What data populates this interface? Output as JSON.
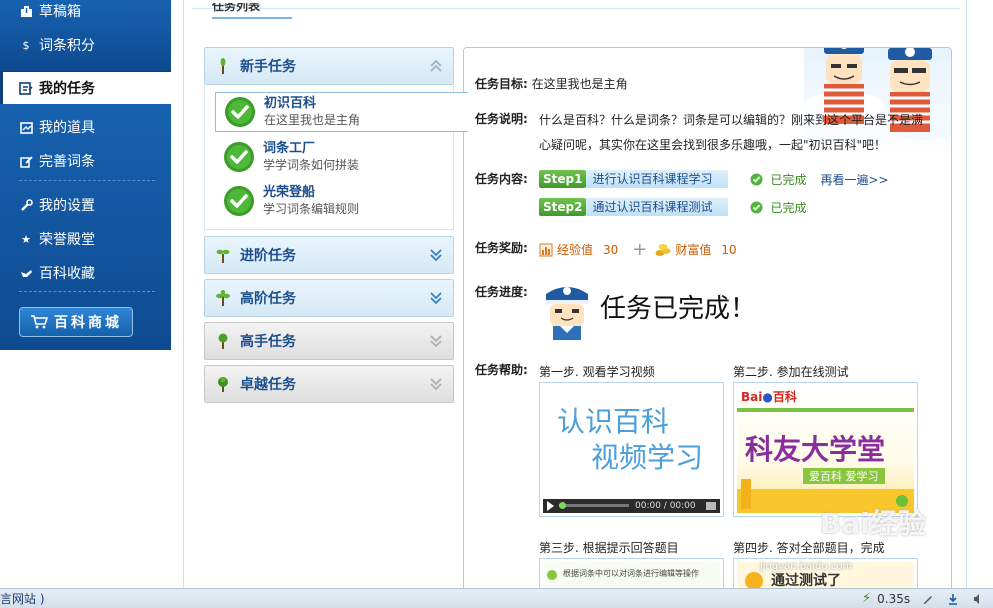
{
  "sidebar": {
    "items_top": [
      {
        "label": "草稿箱",
        "icon": "draft-box-icon"
      },
      {
        "label": "词条积分",
        "icon": "coin-icon"
      }
    ],
    "active": {
      "label": "我的任务",
      "icon": "task-icon"
    },
    "items_mid": [
      {
        "label": "我的道具",
        "icon": "props-icon"
      },
      {
        "label": "完善词条",
        "icon": "edit-entry-icon"
      },
      {
        "label": "我的设置",
        "icon": "wrench-icon"
      },
      {
        "label": "荣誉殿堂",
        "icon": "star-icon"
      },
      {
        "label": "百科收藏",
        "icon": "collection-icon"
      }
    ],
    "shop_label": "百科商城"
  },
  "tab": {
    "title": "任务列表"
  },
  "categories": [
    {
      "label": "新手任务",
      "state": "expanded"
    },
    {
      "label": "进阶任务",
      "state": "collapsed"
    },
    {
      "label": "高阶任务",
      "state": "collapsed"
    },
    {
      "label": "高手任务",
      "state": "locked"
    },
    {
      "label": "卓越任务",
      "state": "locked"
    }
  ],
  "tasks": [
    {
      "name": "初识百科",
      "desc": "在这里我也是主角",
      "active": true
    },
    {
      "name": "词条工厂",
      "desc": "学学词条如何拼装",
      "active": false
    },
    {
      "name": "光荣登船",
      "desc": "学习词条编辑规则",
      "active": false
    }
  ],
  "detail": {
    "goal_key": "任务目标:",
    "goal": "在这里我也是主角",
    "desc_key": "任务说明:",
    "desc": "什么是百科？什么是词条？词条是可以编辑的？刚来到这个平台是不是满心疑问呢，其实你在这里会找到很多乐趣哦，一起\"初识百科\"吧！",
    "content_key": "任务内容:",
    "steps": [
      {
        "badge": "Step1",
        "name": "进行认识百科课程学习",
        "status": "已完成",
        "again": "再看一遍>>"
      },
      {
        "badge": "Step2",
        "name": "通过认识百科课程测试",
        "status": "已完成",
        "again": ""
      }
    ],
    "reward_key": "任务奖励:",
    "rewards": [
      {
        "label": "经验值",
        "value": "30"
      },
      {
        "label": "财富值",
        "value": "10"
      }
    ],
    "progress_key": "任务进度:",
    "progress": "任务已完成！",
    "help_key": "任务帮助:",
    "help": [
      {
        "title": "第一步. 观看学习视频",
        "line1": "认识百科",
        "line2": "视频学习",
        "time": "00:00 / 00:00"
      },
      {
        "title": "第二步. 参加在线测试",
        "logo": "百科",
        "big": "科友大学堂",
        "slogan": "爱百科  爱学习"
      },
      {
        "title": "第三步. 根据提示回答题目",
        "snippet": "根据词条中可以对词条进行编辑等操作"
      },
      {
        "title": "第四步. 答对全部题目，完成",
        "snippet": "通过测试了"
      }
    ]
  },
  "status_bar": {
    "left_text": "言网站 )",
    "speed": "0.35s"
  },
  "watermark": {
    "main": "Bai经验",
    "sub": "jingyan.baidu.com"
  },
  "colors": {
    "sidebar_bg": "#0d3f7c",
    "accent_blue": "#1d4e8e",
    "done_green": "#3a8a1e",
    "reward_orange": "#c85a00"
  }
}
